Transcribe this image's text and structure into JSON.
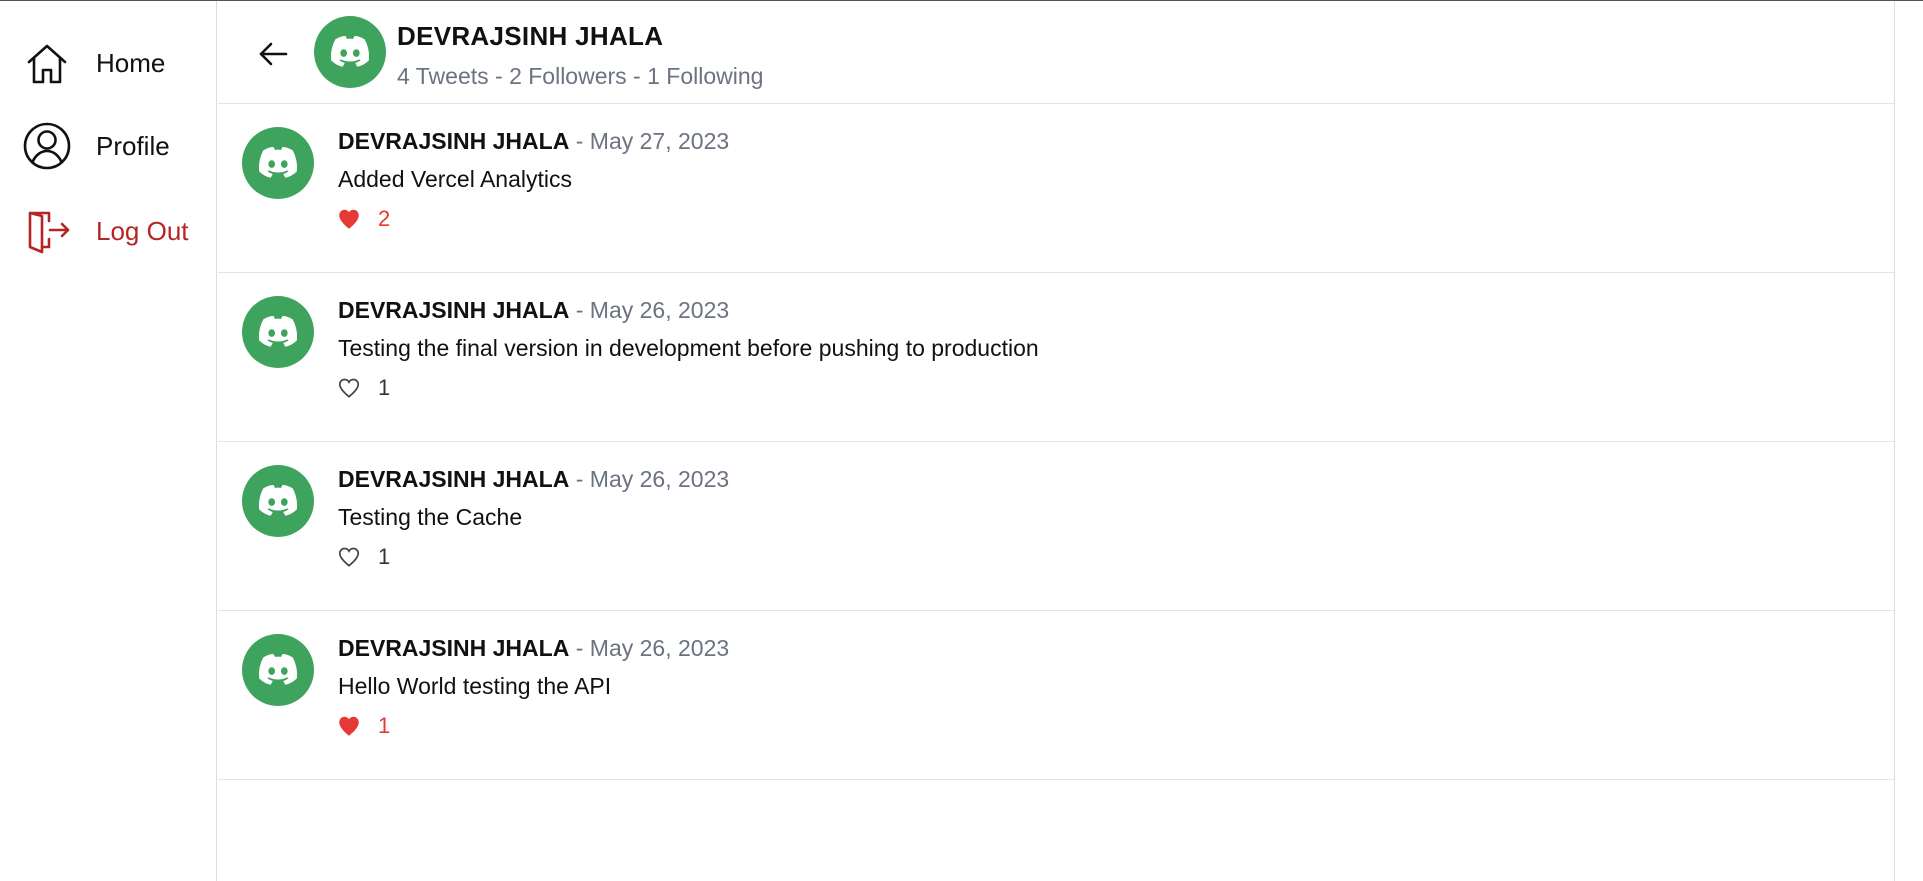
{
  "colors": {
    "accent_green": "#3da35d",
    "logout_red": "#b52525",
    "liked_red": "#e53935",
    "muted_gray": "#6b7280"
  },
  "sidebar": {
    "items": [
      {
        "label": "Home",
        "icon": "home-icon"
      },
      {
        "label": "Profile",
        "icon": "user-circle-icon"
      },
      {
        "label": "Log Out",
        "icon": "logout-icon"
      }
    ]
  },
  "profile": {
    "name": "DEVRAJSINH JHALA",
    "stats": "4 Tweets - 2 Followers - 1 Following",
    "avatar_icon": "discord-icon"
  },
  "tweets": [
    {
      "author": "DEVRAJSINH JHALA",
      "separator": "-",
      "date": "May 27, 2023",
      "text": "Added Vercel Analytics",
      "likes": "2",
      "liked": true
    },
    {
      "author": "DEVRAJSINH JHALA",
      "separator": "-",
      "date": "May 26, 2023",
      "text": "Testing the final version in development before pushing to production",
      "likes": "1",
      "liked": false
    },
    {
      "author": "DEVRAJSINH JHALA",
      "separator": "-",
      "date": "May 26, 2023",
      "text": "Testing the Cache",
      "likes": "1",
      "liked": false
    },
    {
      "author": "DEVRAJSINH JHALA",
      "separator": "-",
      "date": "May 26, 2023",
      "text": "Hello World testing the API",
      "likes": "1",
      "liked": true
    }
  ]
}
